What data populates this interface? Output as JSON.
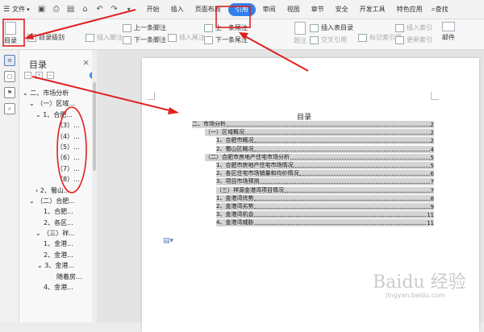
{
  "menubar": {
    "file_label": "文件",
    "tabs": [
      "开始",
      "插入",
      "页面布局",
      "引用",
      "审阅",
      "视图",
      "章节",
      "安全",
      "开发工具",
      "特色应用"
    ],
    "active_tab": "引用",
    "search_label": "查找"
  },
  "ribbon": {
    "toc_button": "目录",
    "toc_level": "目录级别",
    "insert_footnote": "插入脚注",
    "prev_footnote": "上一条脚注",
    "next_footnote": "下一条脚注",
    "insert_endnote": "插入尾注",
    "prev_endnote": "上一条尾注",
    "next_endnote": "下一条尾注",
    "cross_ref": "交叉引用",
    "insert_table_toc": "插入表目录",
    "mark_index": "标记索引项",
    "insert_index": "插入索引",
    "update_index": "更新索引",
    "mail": "邮件",
    "labels": "题注"
  },
  "toc_panel": {
    "title": "目录",
    "items": [
      "二、市场分析",
      "（一）区域...",
      "1、合肥...",
      "（3）...",
      "（4）...",
      "（5）...",
      "（6）...",
      "（7）...",
      "（8）...",
      "2、蜀山...",
      "（二）合肥...",
      "1、合肥...",
      "2、各区...",
      "（三）祥...",
      "1、金港...",
      "2、金港...",
      "3、金港...",
      "随着房...",
      "4、金港..."
    ]
  },
  "document": {
    "heading": "目录",
    "entries": [
      {
        "text": "二、市场分析",
        "page": "2"
      },
      {
        "text": "（一）区域概况",
        "page": "2"
      },
      {
        "text": "1、合肥市概况",
        "page": "2"
      },
      {
        "text": "2、蜀山区概况",
        "page": "4"
      },
      {
        "text": "（二）合肥市房地产住宅市场分析",
        "page": "5"
      },
      {
        "text": "1、合肥市房地产住宅市场情况",
        "page": "5"
      },
      {
        "text": "2、各区住宅市场销量和均价情况",
        "page": "6"
      },
      {
        "text": "3、项目市场预测",
        "page": "7"
      },
      {
        "text": "（三）祥源金港湾项目情况",
        "page": "7"
      },
      {
        "text": "1、金港湾优势",
        "page": "8"
      },
      {
        "text": "2、金港湾劣势",
        "page": "9"
      },
      {
        "text": "3、金港湾机会",
        "page": "11"
      },
      {
        "text": "4、金港湾威胁",
        "page": "11"
      }
    ]
  },
  "watermark": {
    "brand": "Baidu 经验",
    "url": "jingyan.baidu.com"
  },
  "colors": {
    "accent": "#2f80ed",
    "annotation": "#e02020",
    "toc_highlight": "#d4d4d4"
  }
}
